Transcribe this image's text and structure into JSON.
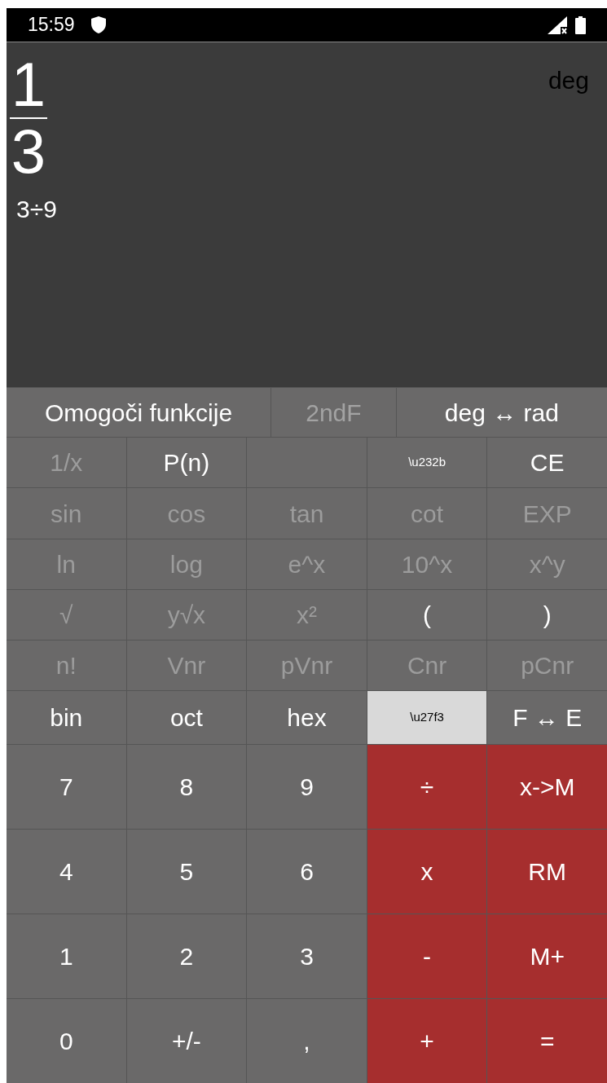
{
  "status_bar": {
    "time": "15:59"
  },
  "display": {
    "numerator": "1",
    "denominator": "3",
    "expression": "3÷9",
    "angle_mode": "deg"
  },
  "top_row": [
    {
      "label": "Omogoči funkcije",
      "disabled": false
    },
    {
      "label": "2ndF",
      "disabled": true
    },
    {
      "label": "deg ↔ rad",
      "disabled": false
    }
  ],
  "function_keys": [
    {
      "label": "1/x",
      "kind": "key",
      "disabled": true
    },
    {
      "label": "P(n)",
      "kind": "key",
      "disabled": false
    },
    {
      "kind": "blank"
    },
    {
      "label": "\\u232b",
      "kind": "symbol",
      "disabled": false
    },
    {
      "label": "CE",
      "kind": "key",
      "disabled": false
    },
    {
      "label": "sin",
      "kind": "key",
      "disabled": true
    },
    {
      "label": "cos",
      "kind": "key",
      "disabled": true
    },
    {
      "label": "tan",
      "kind": "key",
      "disabled": true
    },
    {
      "label": "cot",
      "kind": "key",
      "disabled": true
    },
    {
      "label": "EXP",
      "kind": "key",
      "disabled": true
    },
    {
      "label": "ln",
      "kind": "key",
      "disabled": true
    },
    {
      "label": "log",
      "kind": "key",
      "disabled": true
    },
    {
      "label": "e^x",
      "kind": "key",
      "disabled": true
    },
    {
      "label": "10^x",
      "kind": "key",
      "disabled": true
    },
    {
      "label": "x^y",
      "kind": "key",
      "disabled": true
    },
    {
      "label": "√",
      "kind": "key",
      "disabled": true
    },
    {
      "label": "y√x",
      "kind": "key",
      "disabled": true
    },
    {
      "label": "x²",
      "kind": "key",
      "disabled": true
    },
    {
      "label": "(",
      "kind": "key",
      "disabled": false
    },
    {
      "label": ")",
      "kind": "key",
      "disabled": false
    },
    {
      "label": "n!",
      "kind": "key",
      "disabled": true
    },
    {
      "label": "Vnr",
      "kind": "key",
      "disabled": true
    },
    {
      "label": "pVnr",
      "kind": "key",
      "disabled": true
    },
    {
      "label": "Cnr",
      "kind": "key",
      "disabled": true
    },
    {
      "label": "pCnr",
      "kind": "key",
      "disabled": true
    },
    {
      "label": "bin",
      "kind": "key",
      "disabled": false
    },
    {
      "label": "oct",
      "kind": "key",
      "disabled": false
    },
    {
      "label": "hex",
      "kind": "key",
      "disabled": false
    },
    {
      "label": "\\u27f3",
      "kind": "light",
      "disabled": false
    },
    {
      "label": "F ↔ E",
      "kind": "key",
      "disabled": false
    }
  ],
  "number_keys": [
    {
      "label": "7",
      "kind": "digit"
    },
    {
      "label": "8",
      "kind": "digit"
    },
    {
      "label": "9",
      "kind": "digit"
    },
    {
      "label": "÷",
      "kind": "operator"
    },
    {
      "label": "x->M",
      "kind": "operator"
    },
    {
      "label": "4",
      "kind": "digit"
    },
    {
      "label": "5",
      "kind": "digit"
    },
    {
      "label": "6",
      "kind": "digit"
    },
    {
      "label": "x",
      "kind": "operator"
    },
    {
      "label": "RM",
      "kind": "operator"
    },
    {
      "label": "1",
      "kind": "digit"
    },
    {
      "label": "2",
      "kind": "digit"
    },
    {
      "label": "3",
      "kind": "digit"
    },
    {
      "label": "-",
      "kind": "operator"
    },
    {
      "label": "M+",
      "kind": "operator"
    },
    {
      "label": "0",
      "kind": "digit"
    },
    {
      "label": "+/-",
      "kind": "digit"
    },
    {
      "label": ",",
      "kind": "digit"
    },
    {
      "label": "+",
      "kind": "operator"
    },
    {
      "label": "=",
      "kind": "operator"
    }
  ]
}
